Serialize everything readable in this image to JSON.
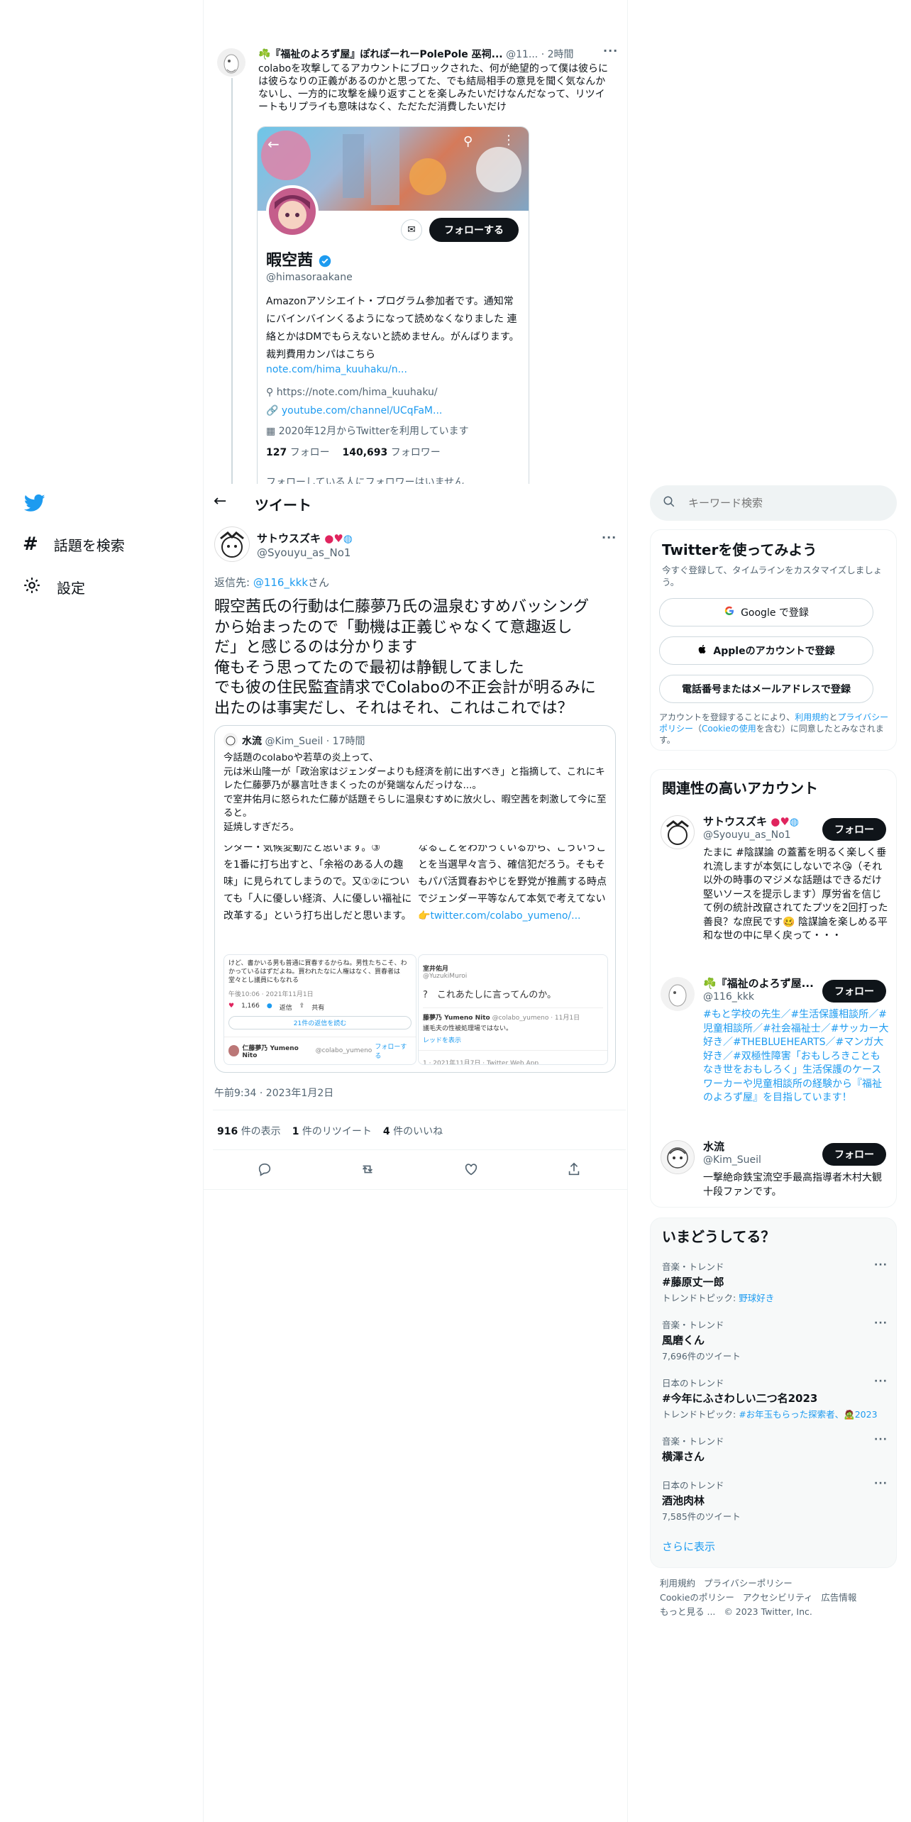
{
  "nav": {
    "explore_label": "話題を検索",
    "settings_label": "設定"
  },
  "parent_tweet": {
    "author_name": "☘️『福祉のよろず屋』ぽれぽーれーPolePole 巫祠...",
    "author_handle": "@11...",
    "time": "· 2時間",
    "text": "colaboを攻撃してるアカウントにブロックされた、何が絶望的って僕は彼らには彼らなりの正義があるのかと思ってた、でも結局相手の意見を聞く気なんかないし、一方的に攻撃を繰り返すことを楽しみたいだけなんだなって、リツイートもリプライも意味はなく、ただただ消費したいだけ"
  },
  "profile_card": {
    "name": "暇空茜",
    "handle": "@himasoraakane",
    "bio": "Amazonアソシエイト・プログラム参加者です。通知常にバインバインくるようになって読めなくなりました 連絡とかはDMでもらえないと読めません。がんばります。裁判費用カンパはこちら",
    "bio_link": "note.com/hima_kuuhaku/n...",
    "location": "https://note.com/hima_kuuhaku/",
    "website": "youtube.com/channel/UCqFaM...",
    "joined": "2020年12月からTwitterを利用しています",
    "following_count": "127",
    "following_label": "フォロー",
    "followers_count": "140,693",
    "followers_label": "フォロワー",
    "follow_button": "フォローする",
    "cutoff_text": "フォローしている人にフォロワーはいません"
  },
  "header": {
    "back_label": "←",
    "title": "ツイート"
  },
  "tweet": {
    "author_name": "サトウスズキ",
    "author_handle": "@Syouyu_as_No1",
    "reply_prefix": "返信先: ",
    "reply_handle": "@116_kkk",
    "reply_suffix": "さん",
    "lines": [
      "暇空茜氏の行動は仁藤夢乃氏の温泉むすめバッシング",
      "から始まったので「動機は正義じゃなくて意趣返し",
      "だ」と感じるのは分かります",
      "俺もそう思ってたので最初は静観してました",
      "でも彼の住民監査請求でColaboの不正会計が明るみに",
      "出たのは事実だし、それはそれ、これはこれでは？"
    ],
    "timestamp": "午前9:34 · 2023年1月2日",
    "views_count": "916",
    "views_label": "件の表示",
    "retweets_count": "1",
    "retweets_label": "件のリツイート",
    "likes_count": "4",
    "likes_label": "件のいいね"
  },
  "quote": {
    "author_name": "水流",
    "author_handle": "@Kim_Sueil",
    "time": "· 17時間",
    "text": "今話題のcolaboや若草の炎上って、\n元は米山隆一が「政治家はジェンダーよりも経済を前に出すべき」と指摘して、これにキレた仁藤夢乃が暴言吐きまくったのが発端なんだっけな...。\nで室井佑月に怒られた仁藤が話題そらしに温泉むすめに放火し、暇空茜を刺激して今に至ると。\n延焼しすぎだろ。",
    "img1_top": "ジター・気候変動だと思います。③",
    "img1_text": "を1番に打ち出すと、「余裕のある人の趣味」に見られてしまうので。又①②についても「人に優しい経済、人に優しい福祉に改革する」という打ち出しだと思います。",
    "img2_text": "なることをわかっているから、こういうことを当選早々言う、確信犯だろう。そもそもパパ活買春おやじを野党が推薦する時点でジェンダー平等なんて本気で考えてない👉",
    "img2_link": "twitter.com/colabo_yumeno/...",
    "img3_text": "けど、書かいる男も普通に買春するからね。男性たちこそ、わかっているはずだよね。買われたなに人権はなく、買春者は堂々とし議員にもなれる",
    "img3_date": "午後10:06 · 2021年11月1日",
    "img3_likes": "1,166",
    "img3_reply": "返信",
    "img3_share": "共有",
    "img3_read": "21件の返信を読む",
    "img3_author": "仁藤夢乃 Yumeno Nito",
    "img3_handle": "@colabo_yumeno",
    "img3_follow": "フォローする",
    "img4_name": "室井佑月",
    "img4_handle": "@YuzukiMuroi",
    "img4_text": "?　これあたしに言ってんのか。",
    "img4_reply_name": "藤夢乃 Yumeno Nito",
    "img4_reply_handle": "@colabo_yumeno · 11月1日",
    "img4_reply_text": "議毛夫の性被処理場ではない。",
    "img4_thread": "レッドを表示",
    "img4_date": "1 · 2021年11月7日 · Twitter Web App"
  },
  "search": {
    "placeholder": "キーワード検索"
  },
  "signup": {
    "title": "Twitterを使ってみよう",
    "subtitle": "今すぐ登録して、タイムラインをカスタマイズしましょう。",
    "google_button": "Google で登録",
    "apple_button": "Appleのアカウントで登録",
    "phone_button": "電話番号またはメールアドレスで登録",
    "terms_prefix": "アカウントを登録することにより、",
    "terms_link": "利用規約",
    "terms_and": "と",
    "privacy_link": "プライバシーポリシー",
    "cookie_prefix": "（",
    "cookie_link": "Cookieの使用",
    "terms_suffix": "を含む）に同意したとみなされます。"
  },
  "relevant": {
    "title": "関連性の高いアカウント",
    "follow_label": "フォロー",
    "accounts": [
      {
        "name": "サトウスズキ",
        "handle": "@Syouyu_as_No1",
        "bio": "たまに #陰謀論 の蓋蓄を明るく楽しく垂れ流しますが本気にしないでネ😘（それ以外の時事のマジメな話題はできるだけ堅いソースを提示します）厚労省を信じて例の統計改竄されてたプツを2回打った善良？な庶民です🥴 陰謀論を楽しめる平和な世の中に早く戻って・・・"
      },
      {
        "name": "☘️『福祉のよろず屋...",
        "handle": "@116_kkk",
        "bio": "#もと学校の先生／#生活保護相談所／#児童相談所／#社会福祉士／#サッカー大好き／#THEBLUEHEARTS／#マンガ大好き／#双極性障害「おもしろきこともなき世をおもしろく」生活保護のケースワーカーや児童相談所の経験から『福祉のよろず屋』を目指しています！"
      },
      {
        "name": "水流",
        "handle": "@Kim_Sueil",
        "bio": "一撃絶命鉄宝流空手最高指導者木村大観十段ファンです。"
      }
    ]
  },
  "trends": {
    "title": "いまどうしてる？",
    "items": [
      {
        "context": "音楽・トレンド",
        "name": "#藤原丈一郎",
        "meta_prefix": "トレンドトピック: ",
        "meta_link": "野球好き"
      },
      {
        "context": "音楽・トレンド",
        "name": "風磨くん",
        "meta_prefix": "7,696件のツイート",
        "meta_link": ""
      },
      {
        "context": "日本のトレンド",
        "name": "#今年にふさわしい二つ名2023",
        "meta_prefix": "トレンドトピック: ",
        "meta_link": "#お年玉もらった探索者、🧟2023"
      },
      {
        "context": "音楽・トレンド",
        "name": "横澤さん",
        "meta_prefix": "",
        "meta_link": ""
      },
      {
        "context": "日本のトレンド",
        "name": "酒池肉林",
        "meta_prefix": "7,585件のツイート",
        "meta_link": ""
      }
    ],
    "show_more": "さらに表示"
  },
  "footer": {
    "line1a": "利用規約",
    "line1b": "プライバシーポリシー",
    "line2a": "Cookieのポリシー",
    "line2b": "アクセシビリティ",
    "line2c": "広告情報",
    "line3a": "もっと見る ...",
    "line3b": "© 2023 Twitter, Inc."
  },
  "colors": {
    "accent": "#1d9bf0",
    "text": "#0f1419",
    "muted": "#536471",
    "border": "#eff3f4"
  }
}
